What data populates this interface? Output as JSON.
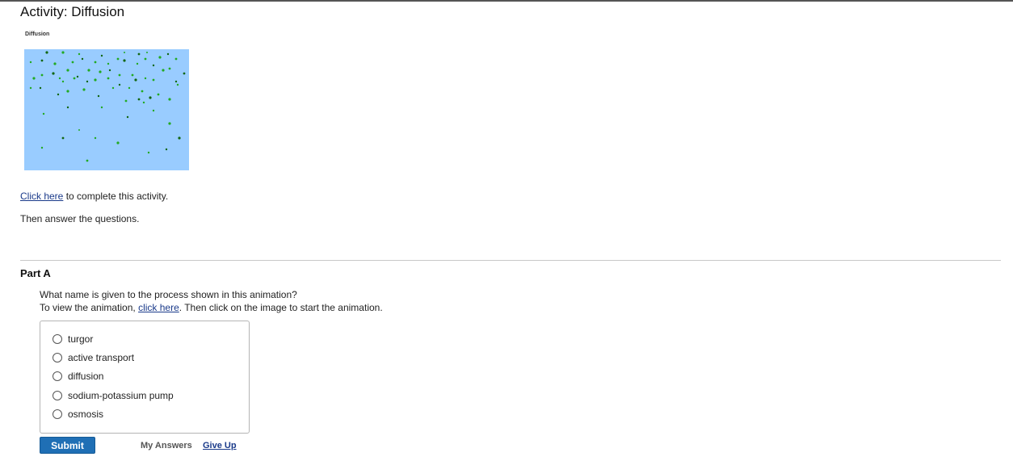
{
  "activity": {
    "title": "Activity: Diffusion",
    "thumbnail_label": "Diffusion",
    "colors": {
      "background": "#99ccff",
      "particle": "#22aa22",
      "particle_dark": "#116611"
    }
  },
  "instructions": {
    "link_text": "Click here",
    "line1_rest": " to complete this activity.",
    "line2": "Then answer the questions."
  },
  "part": {
    "title": "Part A",
    "question_line1": "What name is given to the process shown in this animation?",
    "question_line2_prefix": "To view the animation, ",
    "question_line2_link": "click here",
    "question_line2_suffix": ". Then click on the image to start the animation.",
    "options": [
      "turgor",
      "active transport",
      "diffusion",
      "sodium-potassium pump",
      "osmosis"
    ]
  },
  "actions": {
    "submit_label": "Submit",
    "my_answers_label": "My Answers",
    "give_up_label": "Give Up",
    "accent_color": "#1f6fb5"
  }
}
